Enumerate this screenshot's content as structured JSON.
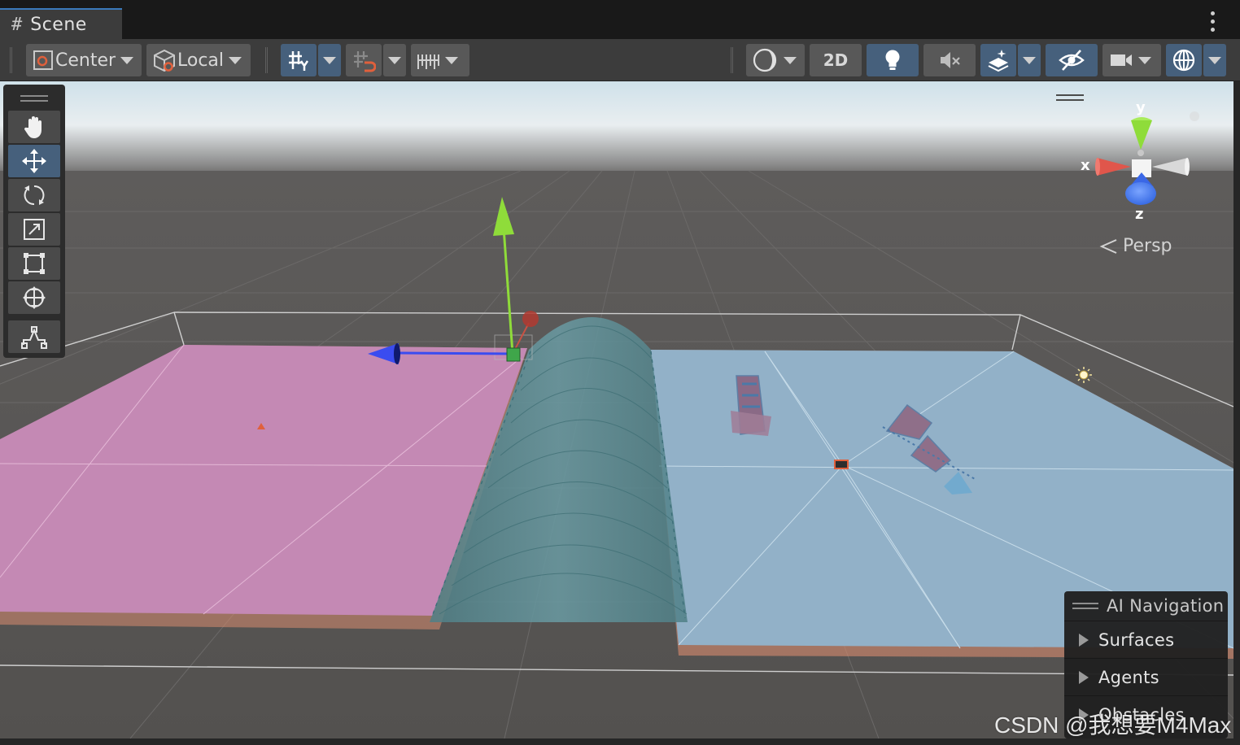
{
  "window": {
    "tab_label": "Scene",
    "tab_icon": "hash-icon"
  },
  "toolbar": {
    "pivot_mode": "Center",
    "pivot_rotation": "Local",
    "draw_mode_label": "",
    "toggle_2d": "2D"
  },
  "tools": [
    "hand-tool",
    "move-tool",
    "rotate-tool",
    "scale-tool",
    "rect-tool",
    "transform-tool",
    "custom-editor-tool"
  ],
  "gizmo": {
    "x_label": "x",
    "y_label": "y",
    "z_label": "z",
    "projection": "Persp"
  },
  "ai_navigation": {
    "title": "AI Navigation",
    "items": [
      "Surfaces",
      "Agents",
      "Obstacles"
    ]
  },
  "watermark": "CSDN @我想要M4Max",
  "colors": {
    "chrome": "#3c3c3c",
    "active_button": "#46607c",
    "navmesh_pink": "#c489b4",
    "navmesh_blue": "#92b1c8",
    "axis_x": "#e0564b",
    "axis_y": "#8fdc3a",
    "axis_z": "#3a4cf0"
  }
}
